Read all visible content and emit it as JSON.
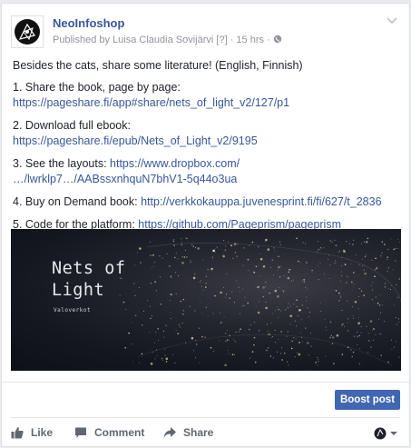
{
  "post": {
    "page_name": "NeoInfoshop",
    "published_by": "Published by Luisa Claudia Sovijärvi",
    "info_marker": "[?]",
    "separator": "·",
    "time": "15 hrs",
    "intro": "Besides the cats, share some literature! (English, Finnish)",
    "items": [
      {
        "label": "1. Share the book, page by page:",
        "link": "https://pageshare.fi/app#share/nets_of_light_v2/127/p1"
      },
      {
        "label": "2. Download full ebook:",
        "link": "https://pageshare.fi/epub/Nets_of_Light_v2/9195"
      },
      {
        "label": "3. See the layouts:",
        "link_line1": "https://www.dropbox.com/",
        "link_line2": "…/lwrklp7…/AABssxnhquN7bhV1-5q44o3ua"
      },
      {
        "label": "4. Buy on Demand book:",
        "link": "http://verkkokauppa.juvenesprint.fi/fi/627/t_2836"
      },
      {
        "label": "5. Code for the platform:",
        "link": "https://github.com/Pageprism/pageprism"
      }
    ],
    "banner": {
      "title_line1": "Nets of",
      "title_line2": "Light",
      "subtitle": "Valoverkot"
    }
  },
  "boost_label": "Boost post",
  "actions": {
    "like": "Like",
    "comment": "Comment",
    "share": "Share"
  },
  "colors": {
    "link": "#365899",
    "boost": "#4267b2",
    "meta": "#90949c"
  }
}
